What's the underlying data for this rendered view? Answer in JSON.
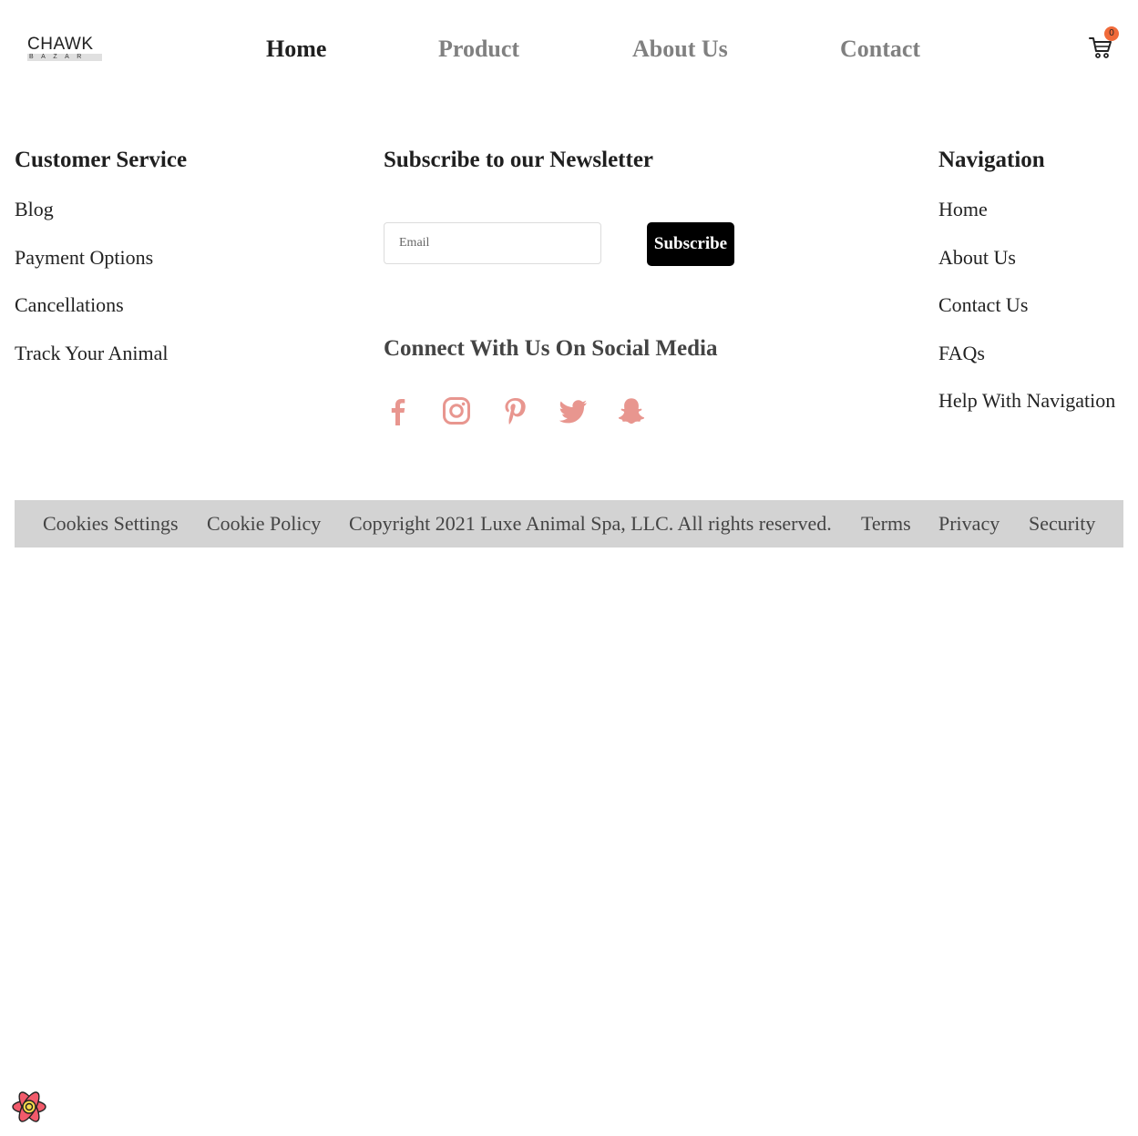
{
  "header": {
    "logo": {
      "main": "CHAWK",
      "sub": "BAZAR"
    },
    "nav": [
      {
        "label": "Home",
        "active": true
      },
      {
        "label": "Product",
        "active": false
      },
      {
        "label": "About Us",
        "active": false
      },
      {
        "label": "Contact",
        "active": false
      }
    ],
    "cart": {
      "icon": "shopping-cart-icon",
      "count": "0",
      "badge_color": "#f06a3a"
    }
  },
  "customer_service": {
    "title": "Customer Service",
    "links": [
      "Blog",
      "Payment Options",
      "Cancellations",
      "Track Your Animal"
    ]
  },
  "newsletter": {
    "title": "Subscribe to our Newsletter",
    "email_placeholder": "Email",
    "email_value": "",
    "subscribe_label": "Subscribe"
  },
  "social": {
    "title": "Connect With Us On Social Media",
    "icon_color": "#e8968f",
    "icons": [
      "facebook-icon",
      "instagram-icon",
      "pinterest-icon",
      "twitter-icon",
      "snapchat-icon"
    ]
  },
  "navigation": {
    "title": "Navigation",
    "links": [
      "Home",
      "About Us",
      "Contact Us",
      "FAQs",
      "Help With Navigation"
    ]
  },
  "footer": {
    "background": "#d3d3d3",
    "items": [
      {
        "label": "Cookies Settings",
        "link": true
      },
      {
        "label": "Cookie Policy",
        "link": true
      },
      {
        "label": "Copyright 2021 Luxe Animal Spa, LLC. All rights reserved.",
        "link": false
      },
      {
        "label": "Terms",
        "link": true
      },
      {
        "label": "Privacy",
        "link": true
      },
      {
        "label": "Security",
        "link": true
      }
    ]
  },
  "devtools": {
    "icon": "react-devtools-icon"
  }
}
